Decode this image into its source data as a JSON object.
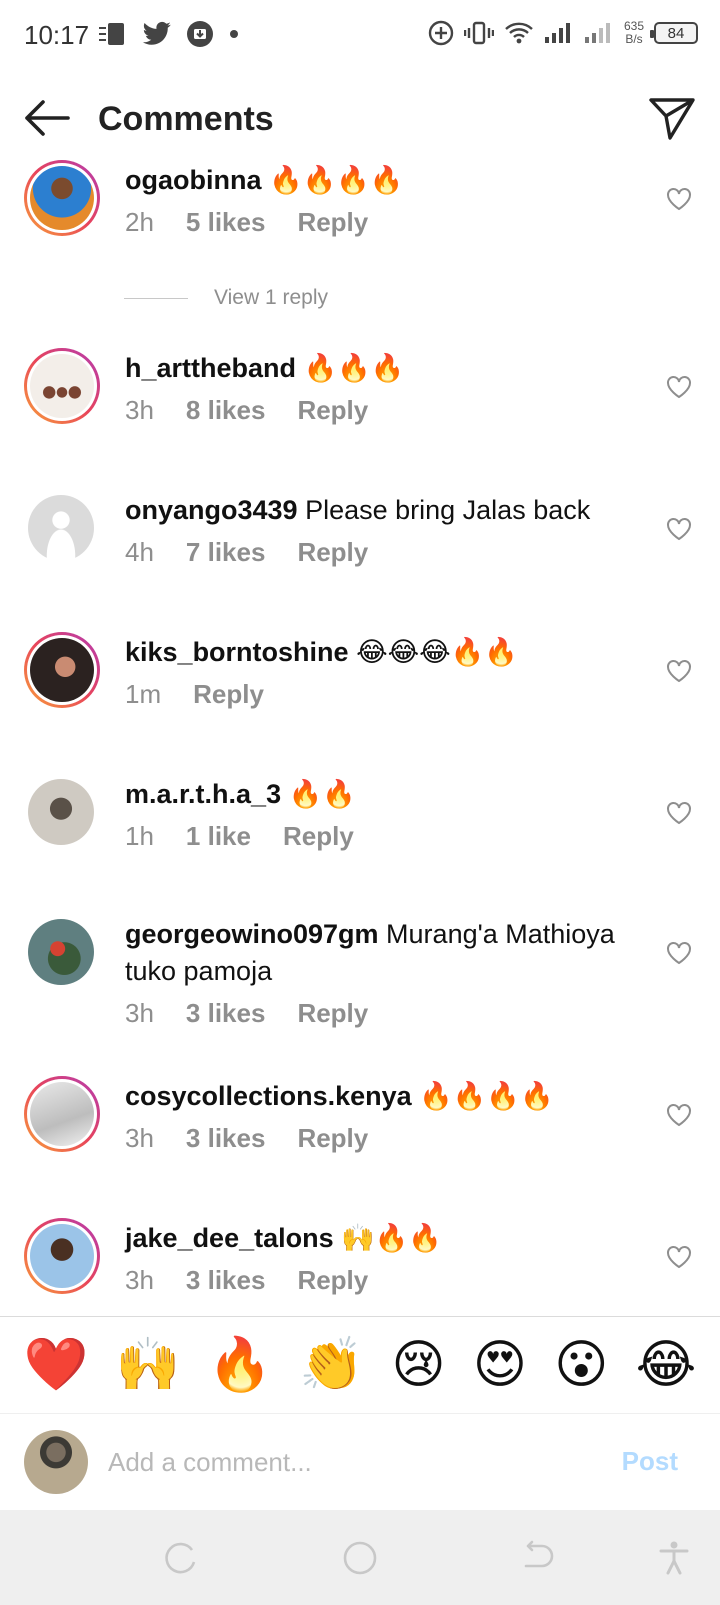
{
  "status_bar": {
    "time": "10:17",
    "net_speed_value": "635",
    "net_speed_unit": "B/s",
    "battery": "84"
  },
  "header": {
    "title": "Comments"
  },
  "comments": [
    {
      "user": "ogaobinna",
      "text": " 🔥🔥🔥🔥",
      "time": "2h",
      "likes": "5 likes",
      "reply": "Reply"
    },
    {
      "user": "h_arttheband",
      "text": " 🔥🔥🔥",
      "time": "3h",
      "likes": "8 likes",
      "reply": "Reply"
    },
    {
      "user": "onyango3439",
      "text": " Please bring Jalas back",
      "time": "4h",
      "likes": "7 likes",
      "reply": "Reply"
    },
    {
      "user": "kiks_borntoshine",
      "text": " 😂😂😂🔥🔥",
      "time": "1m",
      "likes": "",
      "reply": "Reply"
    },
    {
      "user": "m.a.r.t.h.a_3",
      "text": " 🔥🔥",
      "time": "1h",
      "likes": "1 like",
      "reply": "Reply"
    },
    {
      "user": "georgeowino097gm",
      "text": " Murang'a Mathioya tuko pamoja",
      "time": "3h",
      "likes": "3 likes",
      "reply": "Reply"
    },
    {
      "user": "cosycollections.kenya",
      "text": " 🔥🔥🔥🔥",
      "time": "3h",
      "likes": "3 likes",
      "reply": "Reply"
    },
    {
      "user": "jake_dee_talons",
      "text": " 🙌🔥🔥",
      "time": "3h",
      "likes": "3 likes",
      "reply": "Reply"
    }
  ],
  "view_replies_label": "View 1 reply",
  "reactions": [
    "❤️",
    "🙌",
    "🔥",
    "👏",
    "😢",
    "😍",
    "😮",
    "😂"
  ],
  "comment_box": {
    "placeholder": "Add a comment...",
    "post_label": "Post"
  },
  "colors": {
    "accent_ring_start": "#f9a23a",
    "accent_ring_end": "#b23ab5",
    "post_disabled": "#b3dbff",
    "meta_gray": "#8e8e8e"
  }
}
